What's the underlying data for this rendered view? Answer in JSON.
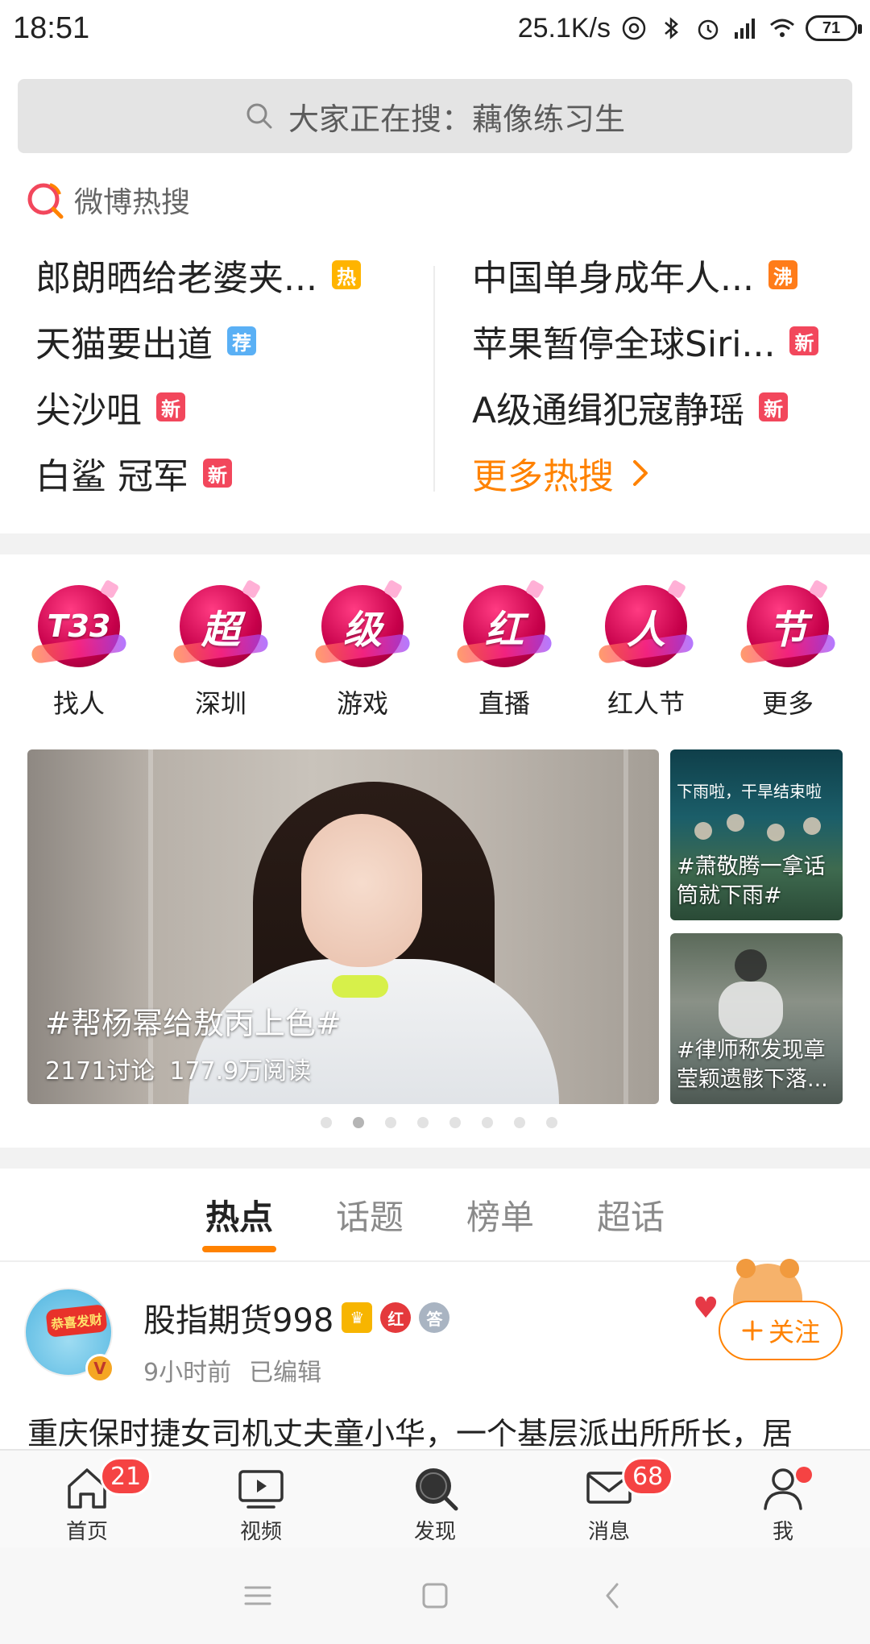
{
  "status_bar": {
    "time": "18:51",
    "speed": "25.1K/s",
    "battery": "71"
  },
  "search": {
    "placeholder": "大家正在搜：藕像练习生"
  },
  "hot_search": {
    "title": "微博热搜",
    "left": [
      {
        "text": "郎朗晒给老婆夹...",
        "badge": "热",
        "badge_type": "hot"
      },
      {
        "text": "天猫要出道",
        "badge": "荐",
        "badge_type": "rec"
      },
      {
        "text": "尖沙咀",
        "badge": "新",
        "badge_type": "new"
      },
      {
        "text": "白鲨 冠军",
        "badge": "新",
        "badge_type": "new"
      }
    ],
    "right": [
      {
        "text": "中国单身成年人...",
        "badge": "沸",
        "badge_type": "boil"
      },
      {
        "text": "苹果暂停全球Siri...",
        "badge": "新",
        "badge_type": "new"
      },
      {
        "text": "A级通缉犯寇静瑶",
        "badge": "新",
        "badge_type": "new"
      }
    ],
    "more": "更多热搜"
  },
  "categories": [
    {
      "glyph": "T33",
      "label": "找人"
    },
    {
      "glyph": "超",
      "label": "深圳"
    },
    {
      "glyph": "级",
      "label": "游戏"
    },
    {
      "glyph": "红",
      "label": "直播"
    },
    {
      "glyph": "人",
      "label": "红人节"
    },
    {
      "glyph": "节",
      "label": "更多"
    }
  ],
  "carousel": {
    "main": {
      "title": "#帮杨幂给敖丙上色#",
      "discussions": "2171讨论",
      "reads": "177.9万阅读"
    },
    "side_top": {
      "overlay": "下雨啦，干旱结束啦",
      "caption": "#萧敬腾一拿话筒就下雨#"
    },
    "side_bottom": {
      "caption": "#律师称发现章莹颖遗骸下落..."
    },
    "dot_count": 8,
    "active_dot": 1
  },
  "tabs": [
    "热点",
    "话题",
    "榜单",
    "超话"
  ],
  "post": {
    "author": "股指期货998",
    "time": "9小时前",
    "edited": "已编辑",
    "follow": "关注",
    "text": "重庆保时捷女司机丈夫童小华，一个基层派出所所长，居",
    "avatar_cap": "恭喜发财",
    "badge_red": "红",
    "badge_grey": "答"
  },
  "bottom_nav": [
    {
      "label": "首页",
      "badge": "21"
    },
    {
      "label": "视频",
      "badge": ""
    },
    {
      "label": "发现",
      "badge": ""
    },
    {
      "label": "消息",
      "badge": "68"
    },
    {
      "label": "我",
      "badge": ""
    }
  ],
  "colors": {
    "accent": "#ff8200",
    "badge_red": "#f54343",
    "hot": "#ffb400",
    "boil": "#ff7c1a",
    "rec": "#5ab0f5",
    "new": "#f2475c"
  }
}
